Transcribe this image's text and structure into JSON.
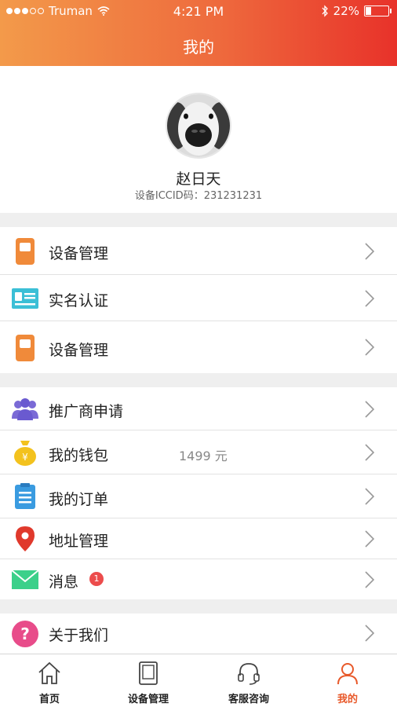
{
  "status_bar": {
    "carrier": "Truman",
    "time": "4:21 PM",
    "battery": "22%"
  },
  "header": {
    "title": "我的"
  },
  "profile": {
    "name": "赵日天",
    "iccid": "设备ICCID码：231231231"
  },
  "groups": [
    {
      "items": [
        {
          "label": "设备管理",
          "icon": "device-icon"
        },
        {
          "label": "实名认证",
          "icon": "id-card-icon"
        },
        {
          "label": "设备管理",
          "icon": "device-icon"
        }
      ]
    },
    {
      "items": [
        {
          "label": "推广商申请",
          "icon": "people-icon"
        },
        {
          "label": "我的钱包",
          "icon": "money-bag-icon",
          "value": "1499 元"
        },
        {
          "label": "我的订单",
          "icon": "clipboard-icon"
        },
        {
          "label": "地址管理",
          "icon": "location-pin-icon"
        },
        {
          "label": "消息",
          "icon": "envelope-icon",
          "badge": "1"
        }
      ]
    },
    {
      "items": [
        {
          "label": "关于我们",
          "icon": "question-icon"
        }
      ]
    }
  ],
  "tabbar": {
    "tabs": [
      {
        "label": "首页",
        "icon": "home-icon"
      },
      {
        "label": "设备管理",
        "icon": "tablet-icon"
      },
      {
        "label": "客服咨询",
        "icon": "headset-icon"
      },
      {
        "label": "我的",
        "icon": "person-icon",
        "active": true
      }
    ]
  },
  "colors": {
    "header_gradient_start": "#f39a4a",
    "header_gradient_end": "#e8322a",
    "active_tab": "#e8592a",
    "badge": "#ec4c4c"
  }
}
